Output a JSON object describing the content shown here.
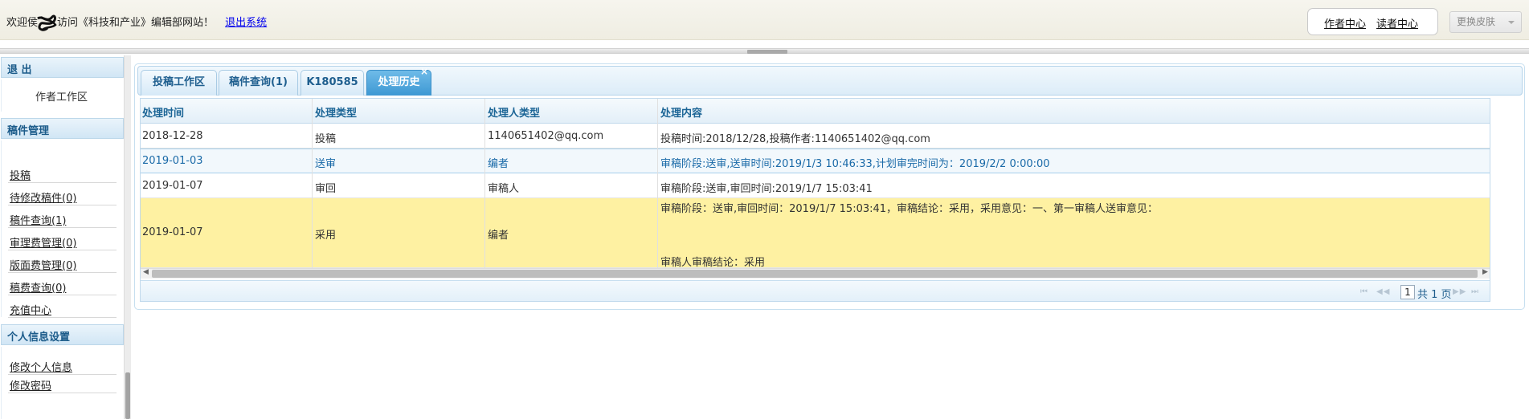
{
  "header": {
    "welcome_prefix": "欢迎侯",
    "welcome_suffix": "访问《科技和产业》编辑部网站！",
    "logout_link": "退出系统",
    "author_center": "作者中心",
    "reader_center": "读者中心",
    "skin_button": "更换皮肤"
  },
  "sidebar": {
    "logout_title": "退 出",
    "author_workspace": "作者工作区",
    "manuscript_section": {
      "title": "稿件管理",
      "items": [
        {
          "label": "投稿"
        },
        {
          "label": "待修改稿件(0)"
        },
        {
          "label": "稿件查询(1)"
        },
        {
          "label": "审理费管理(0)"
        },
        {
          "label": "版面费管理(0)"
        },
        {
          "label": "稿费查询(0)"
        },
        {
          "label": "充值中心"
        }
      ]
    },
    "personal_section": {
      "title": "个人信息设置",
      "items": [
        {
          "label": "修改个人信息"
        },
        {
          "label": "修改密码"
        }
      ]
    }
  },
  "tabs": [
    {
      "label": "投稿工作区"
    },
    {
      "label": "稿件查询(1)"
    },
    {
      "label": "K180585"
    },
    {
      "label": "处理历史",
      "close": "×",
      "active": true
    }
  ],
  "grid": {
    "columns": [
      "处理时间",
      "处理类型",
      "处理人类型",
      "处理内容"
    ],
    "rows": [
      {
        "time": "2018-12-28",
        "type": "投稿",
        "handler": "1140651402@qq.com",
        "content": "投稿时间:2018/12/28,投稿作者:1140651402@qq.com"
      },
      {
        "time": "2019-01-03",
        "type": "送审",
        "handler": "编者",
        "content": "审稿阶段:送审,送审时间:2019/1/3 10:46:33,计划审完时间为：2019/2/2 0:00:00"
      },
      {
        "time": "2019-01-07",
        "type": "审回",
        "handler": "审稿人",
        "content": "审稿阶段:送审,审回时间:2019/1/7 15:03:41"
      },
      {
        "time": "2019-01-07",
        "type": "采用",
        "handler": "编者",
        "content": "审稿阶段：送审,审回时间：2019/1/7 15:03:41，审稿结论：采用，采用意见：一、第一审稿人送审意见：",
        "content_extra": "审稿人审稿结论：采用"
      }
    ],
    "pager": {
      "first": "⏮",
      "prev": "◀◀",
      "page": "1",
      "total": "共 1 页",
      "next": "▶▶",
      "last": "⏭"
    }
  }
}
